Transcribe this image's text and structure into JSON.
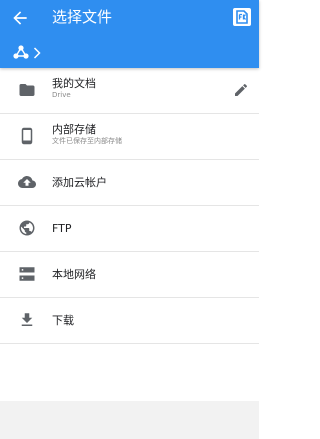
{
  "colors": {
    "primary": "#2f8ef0",
    "icon": "#5f6368",
    "divider": "#e5e5e5"
  },
  "header": {
    "title": "选择文件",
    "back_icon": "arrow-left-icon",
    "action_icon": "sdcard-badge-icon",
    "breadcrumb_root_icon": "network-nodes-icon",
    "breadcrumb_separator_icon": "chevron-right-icon"
  },
  "items": [
    {
      "label": "我的文档",
      "subtitle": "Drive",
      "icon": "folder-icon",
      "edit_icon": "pencil-icon"
    },
    {
      "label": "内部存储",
      "subtitle": "文件已保存至内部存储",
      "icon": "phone-icon"
    },
    {
      "label": "添加云帐户",
      "icon": "cloud-upload-icon"
    },
    {
      "label": "FTP",
      "icon": "globe-icon"
    },
    {
      "label": "本地网络",
      "icon": "server-icon"
    },
    {
      "label": "下载",
      "icon": "download-icon"
    }
  ]
}
